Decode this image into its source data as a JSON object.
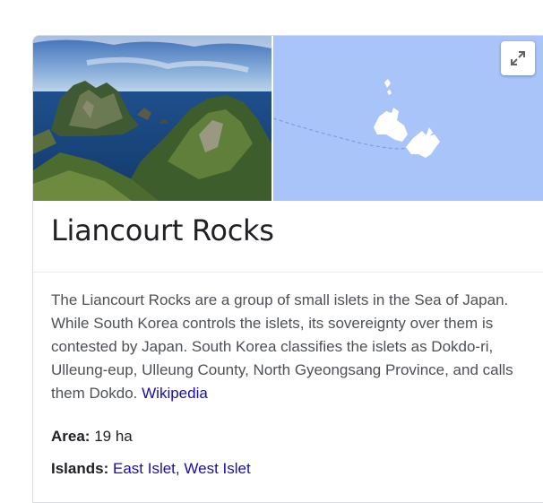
{
  "panel": {
    "title": "Liancourt Rocks",
    "expand_icon": "expand-arrows-icon",
    "description": {
      "text": "The Liancourt Rocks are a group of small islets in the Sea of Japan. While South Korea controls the islets, its sovereignty over them is contested by Japan. South Korea classifies the islets as Dokdo-ri, Ulleung-eup, Ulleung County, North Gyeongsang Province, and calls them Dokdo.",
      "source_link": "Wikipedia"
    },
    "facts": {
      "area_label": "Area:",
      "area_value": "19 ha",
      "islands_label": "Islands:",
      "island_1": "East Islet",
      "island_sep": ",",
      "island_2": "West Islet"
    }
  },
  "colors": {
    "map_water": "#a8c4f8",
    "map_land": "#ffffff",
    "link": "#1a0dab",
    "title_text": "#202124",
    "body_text": "#4d5156"
  }
}
